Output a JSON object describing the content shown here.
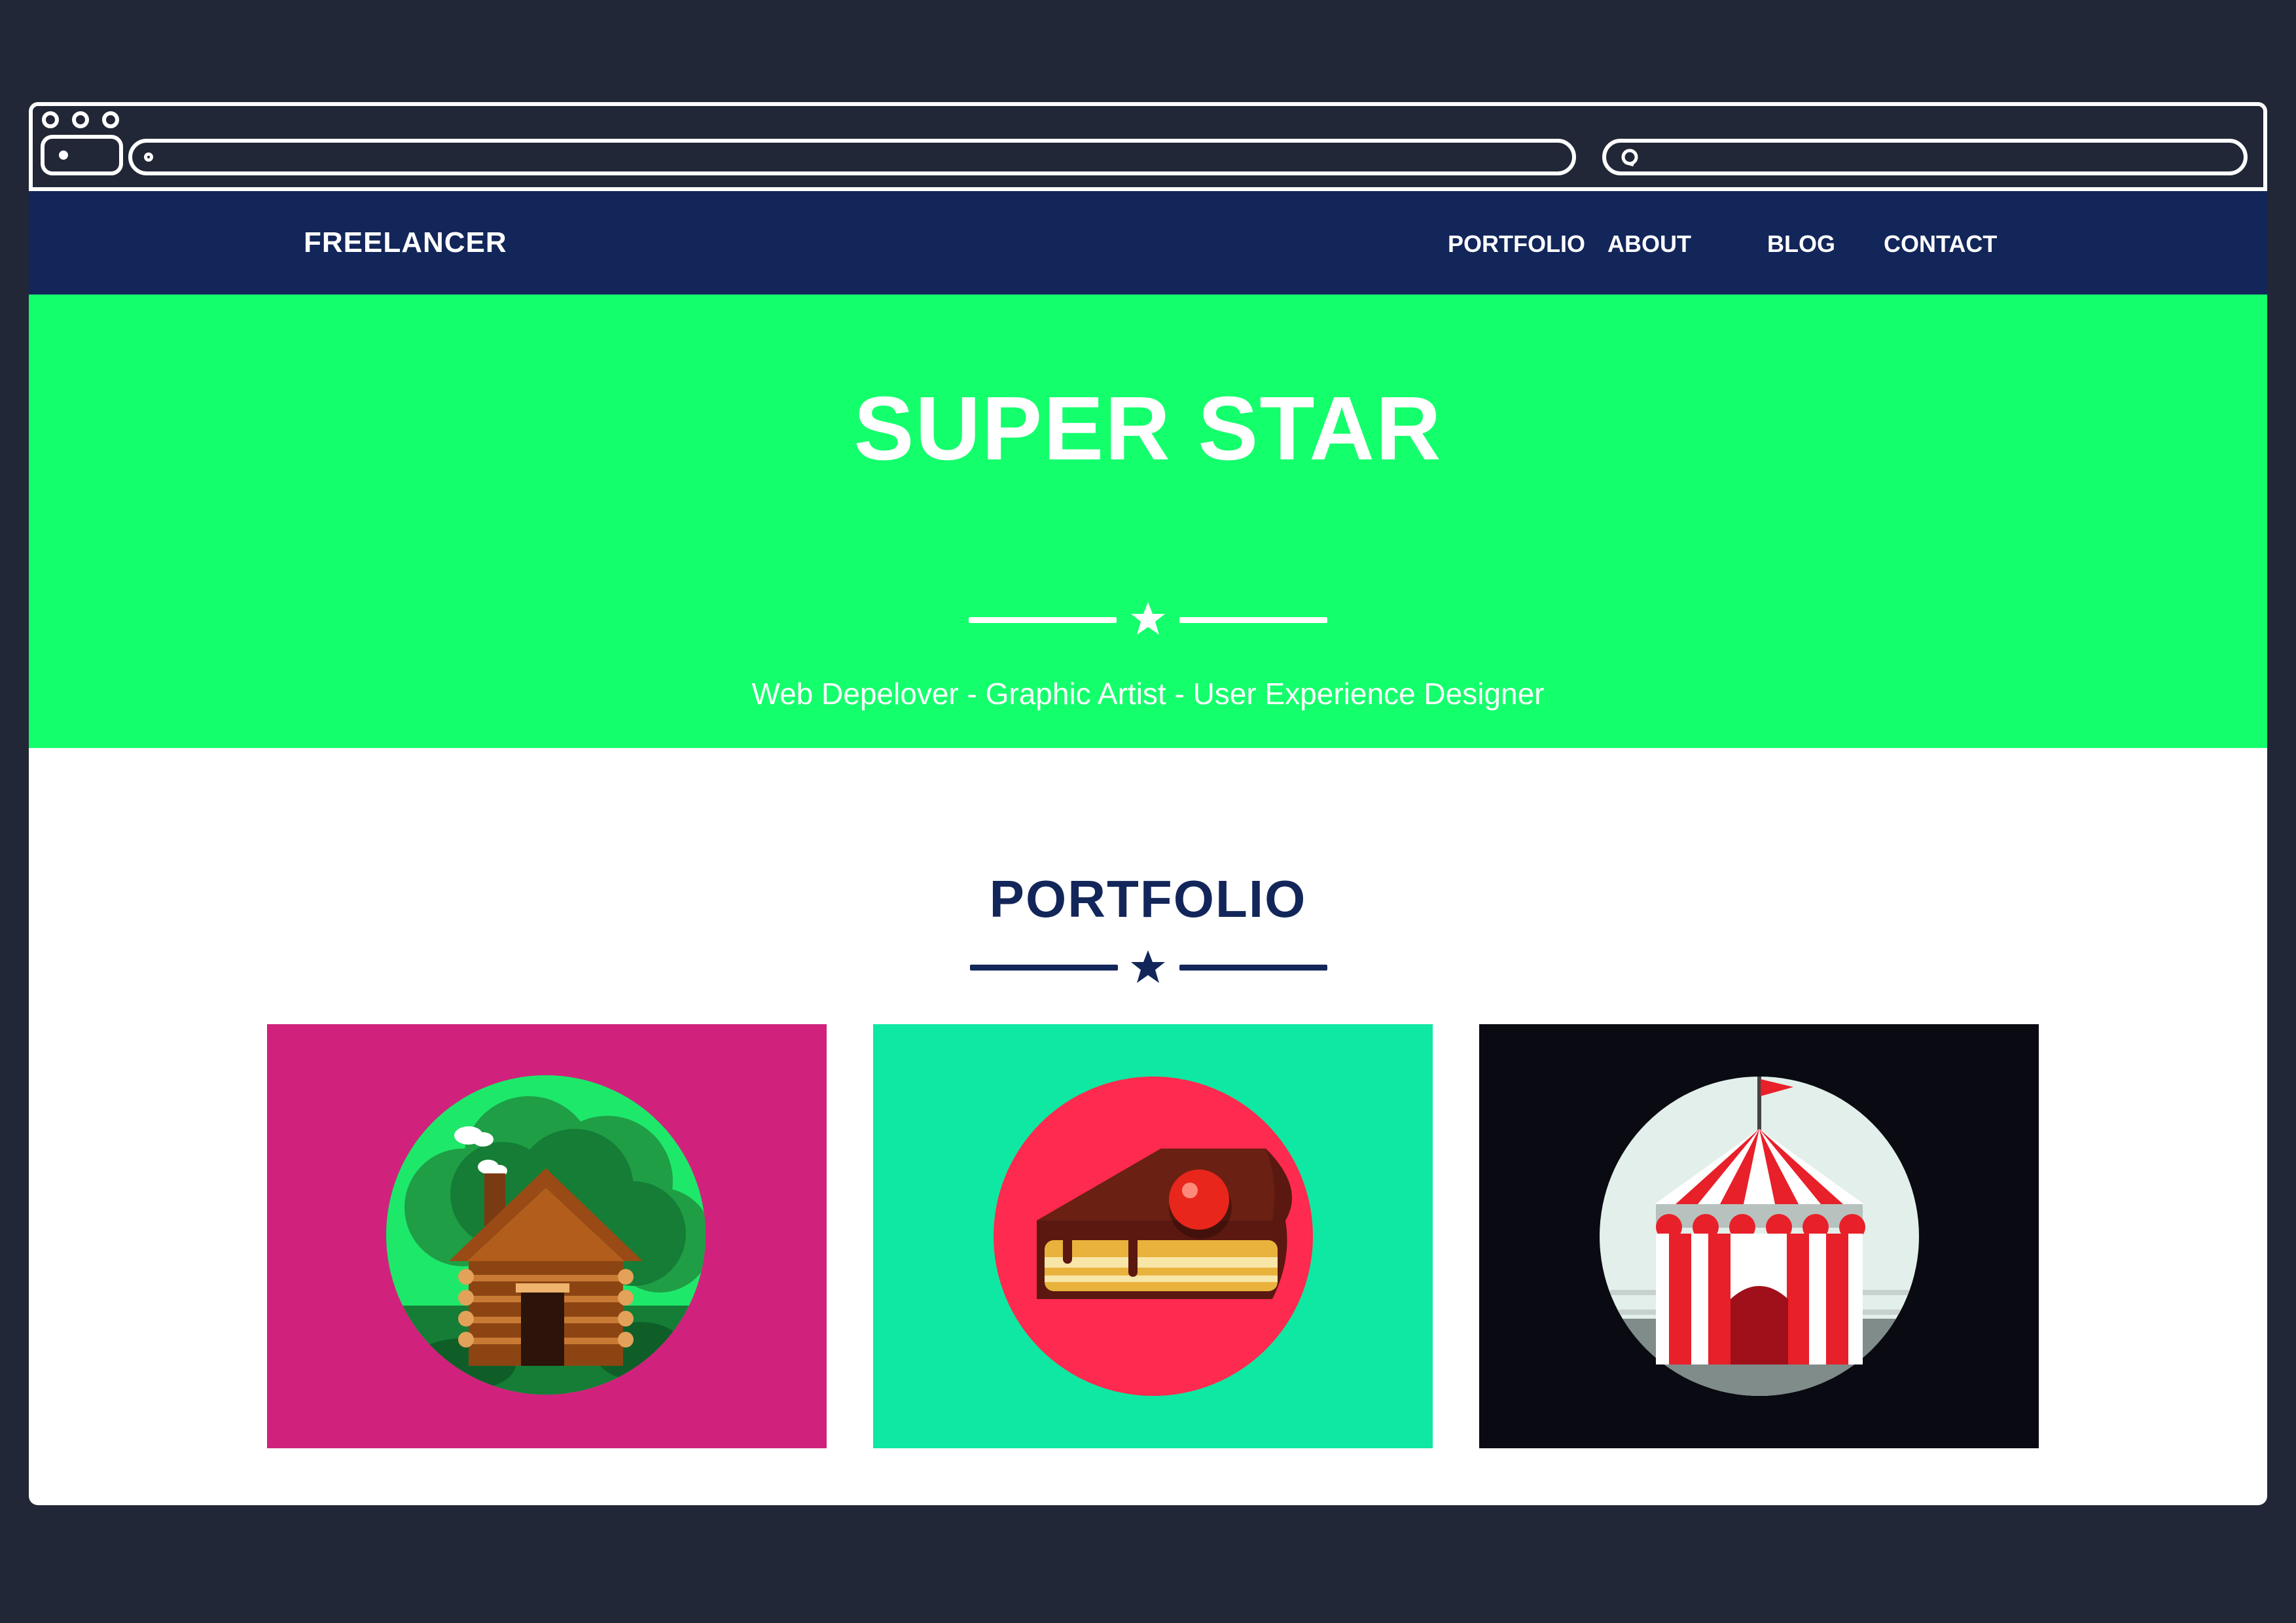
{
  "navbar": {
    "brand": "FREELANCER",
    "links": [
      "PORTFOLIO",
      "ABOUT",
      "BLOG",
      "CONTACT"
    ]
  },
  "hero": {
    "title": "SUPER STAR",
    "subtitle": "Web Depelover - Graphic Artist - User Experience Designer",
    "divider_icon": "star-icon"
  },
  "portfolio": {
    "title": "PORTFOLIO",
    "divider_icon": "star-icon",
    "items": [
      {
        "icon": "log-cabin-icon",
        "background": "#d0227c",
        "circle": "#1ee86a"
      },
      {
        "icon": "cake-slice-icon",
        "background": "#0fe8a2",
        "circle": "#ff2a4f"
      },
      {
        "icon": "circus-tent-icon",
        "background": "#0a0b12",
        "circle": "#e2efea"
      }
    ]
  },
  "colors": {
    "page_background": "#212736",
    "navbar": "#13265a",
    "hero": "#14ff6c",
    "heading": "#13265a"
  }
}
